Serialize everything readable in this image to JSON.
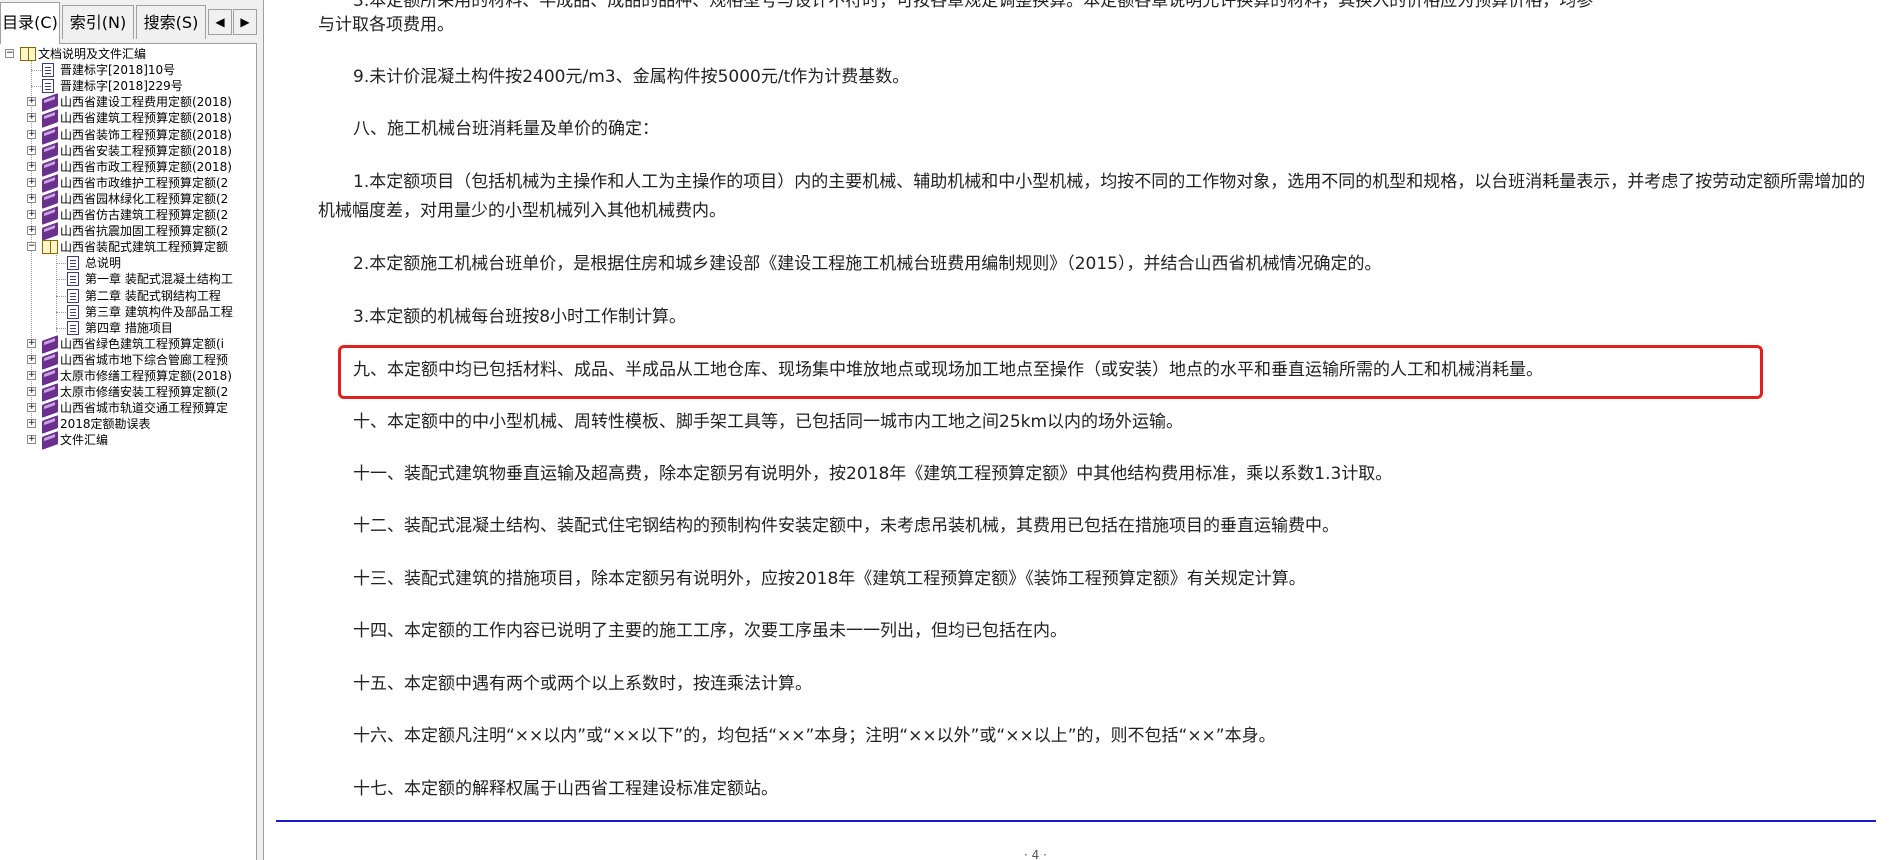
{
  "nav": {
    "tabs": [
      {
        "label": "目录(C)"
      },
      {
        "label": "索引(N)"
      },
      {
        "label": "搜索(S)"
      }
    ],
    "prev_icon": "◀",
    "next_icon": "▶",
    "tree": [
      {
        "label": "文档说明及文件汇编",
        "icon": "book-open-icon",
        "expander": "−"
      },
      {
        "label": "晋建标字[2018]10号",
        "icon": "page-icon"
      },
      {
        "label": "晋建标字[2018]229号",
        "icon": "page-icon"
      },
      {
        "label": "山西省建设工程费用定额(2018)",
        "icon": "book-icon",
        "expander": "+"
      },
      {
        "label": "山西省建筑工程预算定额(2018)",
        "icon": "book-icon",
        "expander": "+"
      },
      {
        "label": "山西省装饰工程预算定额(2018)",
        "icon": "book-icon",
        "expander": "+"
      },
      {
        "label": "山西省安装工程预算定额(2018)",
        "icon": "book-icon",
        "expander": "+"
      },
      {
        "label": "山西省市政工程预算定额(2018)",
        "icon": "book-icon",
        "expander": "+"
      },
      {
        "label": "山西省市政维护工程预算定额(2",
        "icon": "book-icon",
        "expander": "+"
      },
      {
        "label": "山西省园林绿化工程预算定额(2",
        "icon": "book-icon",
        "expander": "+"
      },
      {
        "label": "山西省仿古建筑工程预算定额(2",
        "icon": "book-icon",
        "expander": "+"
      },
      {
        "label": "山西省抗震加固工程预算定额(2",
        "icon": "book-icon",
        "expander": "+"
      },
      {
        "label": "山西省装配式建筑工程预算定额",
        "icon": "book-open-icon",
        "expander": "−"
      },
      {
        "label": "总说明",
        "icon": "page-icon"
      },
      {
        "label": "第一章  装配式混凝土结构工",
        "icon": "page-icon"
      },
      {
        "label": "第二章  装配式钢结构工程",
        "icon": "page-icon"
      },
      {
        "label": "第三章  建筑构件及部品工程",
        "icon": "page-icon"
      },
      {
        "label": "第四章  措施项目",
        "icon": "page-icon"
      },
      {
        "label": "山西省绿色建筑工程预算定额(i",
        "icon": "book-icon",
        "expander": "+"
      },
      {
        "label": "山西省城市地下综合管廊工程预",
        "icon": "book-icon",
        "expander": "+"
      },
      {
        "label": "太原市修缮工程预算定额(2018)",
        "icon": "book-icon",
        "expander": "+"
      },
      {
        "label": "太原市修缮安装工程预算定额(2",
        "icon": "book-icon",
        "expander": "+"
      },
      {
        "label": "山西省城市轨道交通工程预算定",
        "icon": "book-icon",
        "expander": "+"
      },
      {
        "label": "2018定额勘误表",
        "icon": "book-icon",
        "expander": "+"
      },
      {
        "label": "文件汇编",
        "icon": "book-icon",
        "expander": "+"
      }
    ]
  },
  "document": {
    "paragraphs": [
      {
        "text": "3.本定额所采用的材料、半成品、成品的品种、规格型号与设计不符时，可按各章规定调整换算。本定额各章说明允许换算的材料，其换入的价格应为预算价格，均参",
        "partial": true
      },
      {
        "text": "与计取各项费用。"
      },
      {
        "text": "9.未计价混凝土构件按2400元/m3、金属构件按5000元/t作为计费基数。"
      },
      {
        "text": "八、施工机械台班消耗量及单价的确定："
      },
      {
        "text": "1.本定额项目（包括机械为主操作和人工为主操作的项目）内的主要机械、辅助机械和中小型机械，均按不同的工作物对象，选用不同的机型和规格，以台班消耗量表示，并考虑了按劳动定额所需增加的机械幅度差，对用量少的小型机械列入其他机械费内。"
      },
      {
        "text": "2.本定额施工机械台班单价，是根据住房和城乡建设部《建设工程施工机械台班费用编制规则》（2015），并结合山西省机械情况确定的。"
      },
      {
        "text": "3.本定额的机械每台班按8小时工作制计算。"
      },
      {
        "text": "九、本定额中均已包括材料、成品、半成品从工地仓库、现场集中堆放地点或现场加工地点至操作（或安装）地点的水平和垂直运输所需的人工和机械消耗量。",
        "highlighted": true
      },
      {
        "text": "十、本定额中的中小型机械、周转性模板、脚手架工具等，已包括同一城市内工地之间25km以内的场外运输。"
      },
      {
        "text": "十一、装配式建筑物垂直运输及超高费，除本定额另有说明外，按2018年《建筑工程预算定额》中其他结构费用标准，乘以系数1.3计取。"
      },
      {
        "text": "十二、装配式混凝土结构、装配式住宅钢结构的预制构件安装定额中，未考虑吊装机械，其费用已包括在措施项目的垂直运输费中。"
      },
      {
        "text": "十三、装配式建筑的措施项目，除本定额另有说明外，应按2018年《建筑工程预算定额》《装饰工程预算定额》有关规定计算。"
      },
      {
        "text": "十四、本定额的工作内容已说明了主要的施工工序，次要工序虽未一一列出，但均已包括在内。"
      },
      {
        "text": "十五、本定额中遇有两个或两个以上系数时，按连乘法计算。"
      },
      {
        "text": "十六、本定额凡注明“××以内”或“××以下”的，均包括“××”本身；注明“××以外”或“××以上”的，则不包括“××”本身。"
      },
      {
        "text": "十七、本定额的解释权属于山西省工程建设标准定额站。"
      }
    ],
    "footer_fragment": "· 4 ·",
    "highlight_color": "#e0201c",
    "rule_color": "#1a1ac8"
  }
}
